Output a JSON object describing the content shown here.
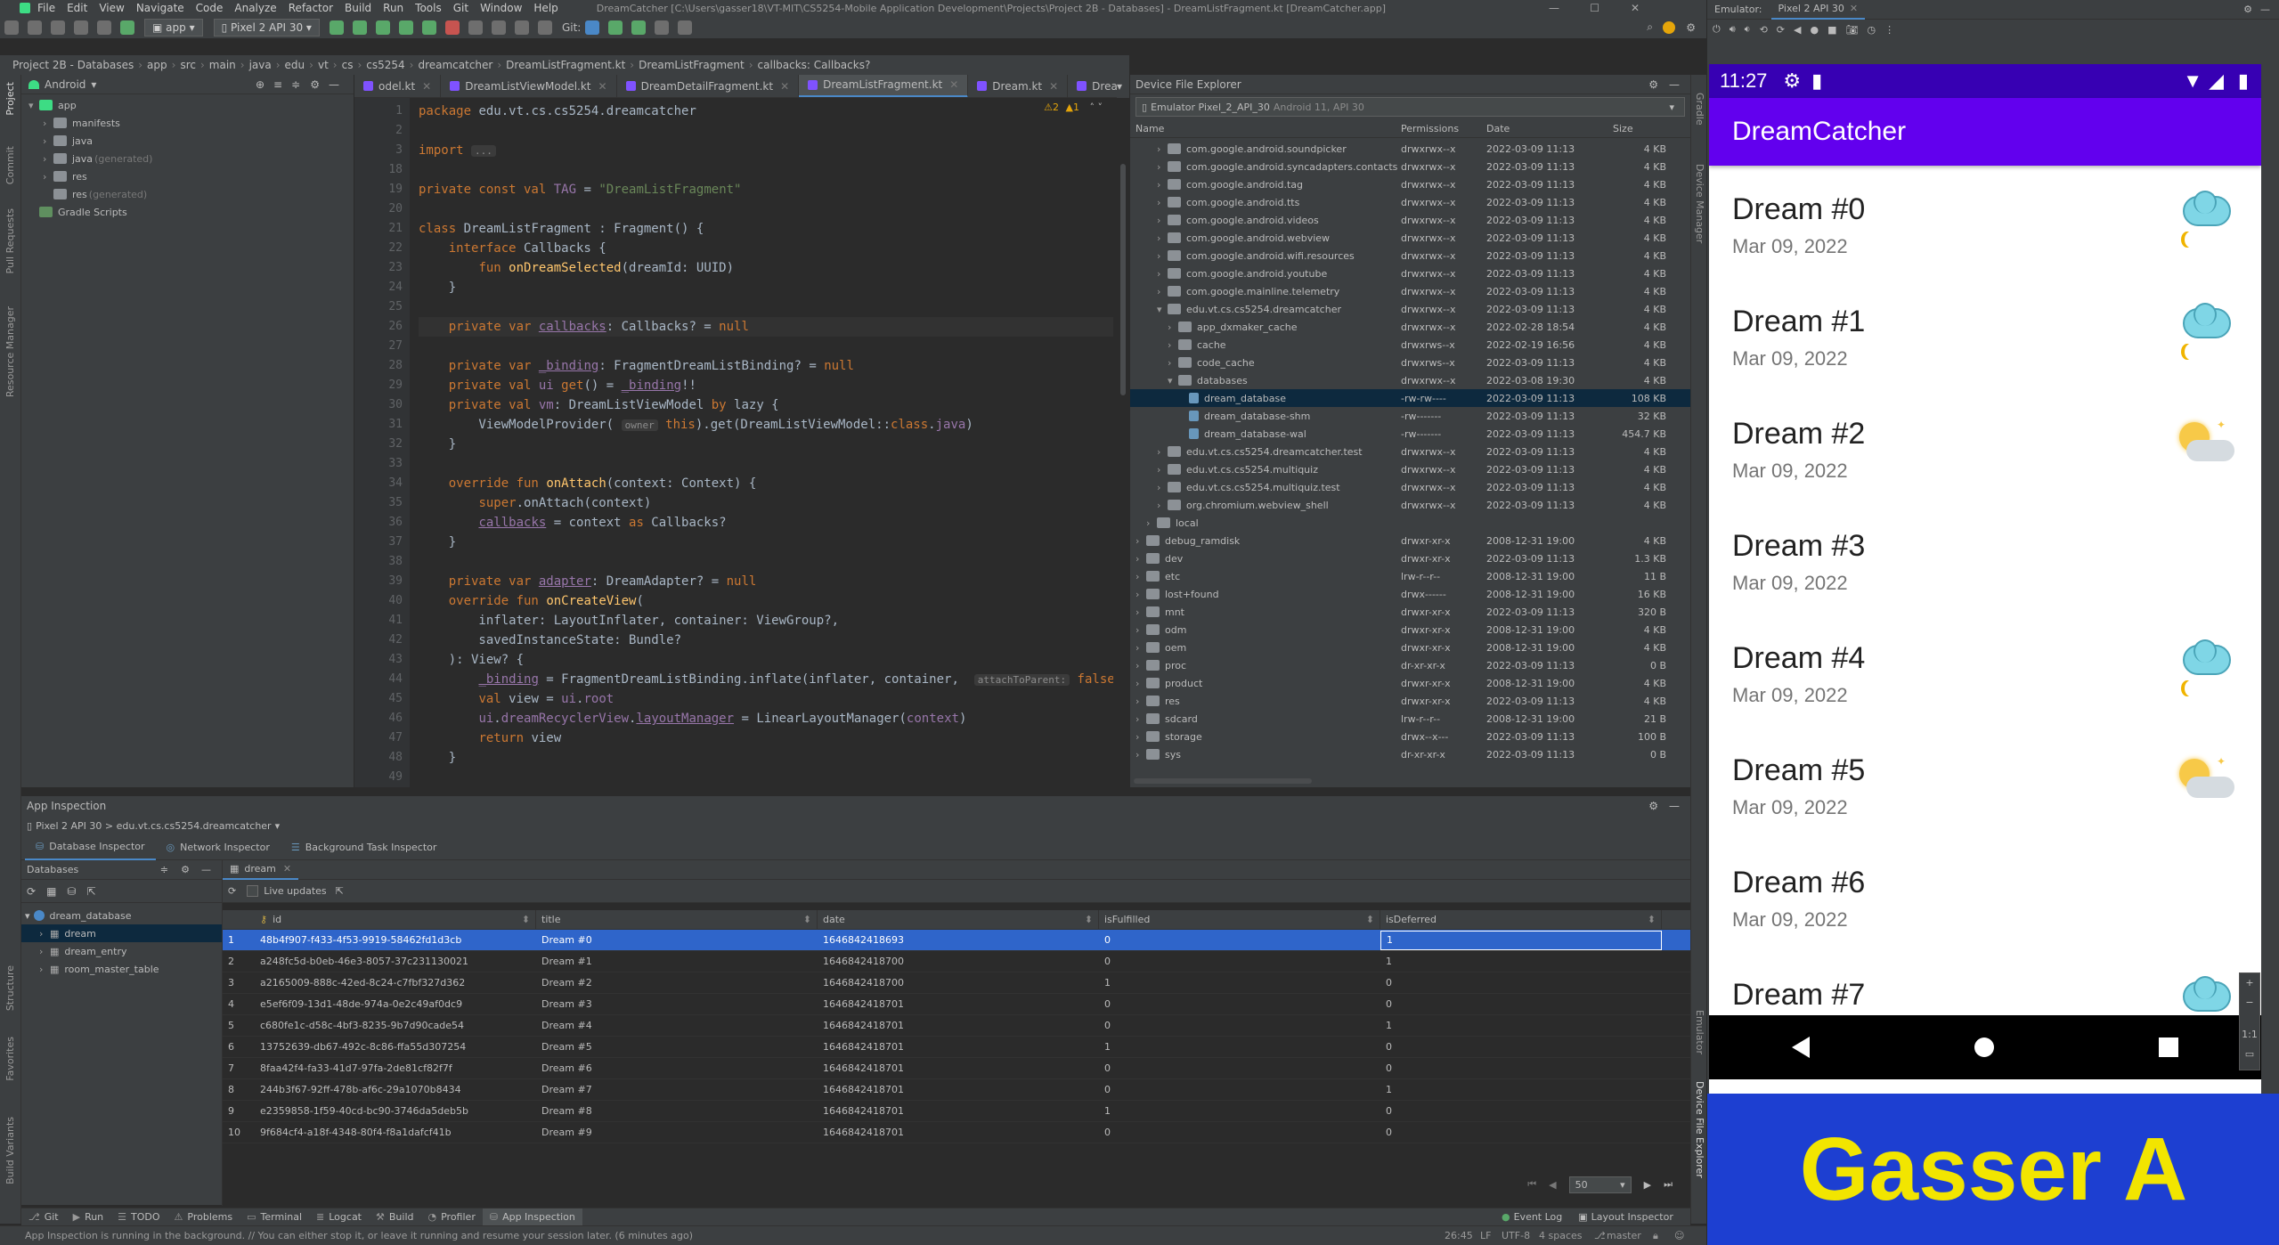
{
  "menu": {
    "items": [
      "File",
      "Edit",
      "View",
      "Navigate",
      "Code",
      "Analyze",
      "Refactor",
      "Build",
      "Run",
      "Tools",
      "Git",
      "Window",
      "Help"
    ],
    "title": "DreamCatcher [C:\\Users\\gasser18\\VT-MIT\\CS5254-Mobile Application Development\\Projects\\Project 2B - Databases] - DreamListFragment.kt [DreamCatcher.app]"
  },
  "toolbar": {
    "config": "app",
    "device": "Pixel 2 API 30",
    "git_label": "Git:"
  },
  "breadcrumb": [
    "Project 2B - Databases",
    "app",
    "src",
    "main",
    "java",
    "edu",
    "vt",
    "cs",
    "cs5254",
    "dreamcatcher",
    "DreamListFragment.kt",
    "DreamListFragment",
    "callbacks: Callbacks?"
  ],
  "project": {
    "view": "Android",
    "tree": [
      {
        "label": "app",
        "suffix": ""
      },
      {
        "label": "manifests",
        "suffix": ""
      },
      {
        "label": "java",
        "suffix": ""
      },
      {
        "label": "java",
        "suffix": " (generated)"
      },
      {
        "label": "res",
        "suffix": ""
      },
      {
        "label": "res",
        "suffix": " (generated)"
      },
      {
        "label": "Gradle Scripts",
        "suffix": ""
      }
    ]
  },
  "editor": {
    "tabs": [
      "odel.kt",
      "DreamListViewModel.kt",
      "DreamDetailFragment.kt",
      "DreamListFragment.kt",
      "Dream.kt",
      "DreamWithEntries.kt"
    ],
    "active_tab": 3,
    "warnings": "⚠2",
    "weak_warnings": "▲1",
    "line_numbers": [
      "1",
      "2",
      "3",
      "18",
      "19",
      "20",
      "21",
      "22",
      "23",
      "24",
      "25",
      "26",
      "27",
      "28",
      "29",
      "30",
      "31",
      "32",
      "33",
      "34",
      "35",
      "36",
      "37",
      "38",
      "39",
      "40",
      "41",
      "42",
      "43",
      "44",
      "45",
      "46",
      "47",
      "48",
      "49"
    ]
  },
  "dfe": {
    "title": "Device File Explorer",
    "device": "Emulator Pixel_2_API_30",
    "device_sub": "Android 11, API 30",
    "columns": [
      "Name",
      "Permissions",
      "Date",
      "Size"
    ],
    "rows": [
      {
        "name": "com.google.android.soundpicker",
        "perm": "drwxrwx--x",
        "date": "2022-03-09 11:13",
        "size": "4 KB",
        "indent": 2,
        "type": "folder"
      },
      {
        "name": "com.google.android.syncadapters.contacts",
        "perm": "drwxrwx--x",
        "date": "2022-03-09 11:13",
        "size": "4 KB",
        "indent": 2,
        "type": "folder"
      },
      {
        "name": "com.google.android.tag",
        "perm": "drwxrwx--x",
        "date": "2022-03-09 11:13",
        "size": "4 KB",
        "indent": 2,
        "type": "folder"
      },
      {
        "name": "com.google.android.tts",
        "perm": "drwxrwx--x",
        "date": "2022-03-09 11:13",
        "size": "4 KB",
        "indent": 2,
        "type": "folder"
      },
      {
        "name": "com.google.android.videos",
        "perm": "drwxrwx--x",
        "date": "2022-03-09 11:13",
        "size": "4 KB",
        "indent": 2,
        "type": "folder"
      },
      {
        "name": "com.google.android.webview",
        "perm": "drwxrwx--x",
        "date": "2022-03-09 11:13",
        "size": "4 KB",
        "indent": 2,
        "type": "folder"
      },
      {
        "name": "com.google.android.wifi.resources",
        "perm": "drwxrwx--x",
        "date": "2022-03-09 11:13",
        "size": "4 KB",
        "indent": 2,
        "type": "folder"
      },
      {
        "name": "com.google.android.youtube",
        "perm": "drwxrwx--x",
        "date": "2022-03-09 11:13",
        "size": "4 KB",
        "indent": 2,
        "type": "folder"
      },
      {
        "name": "com.google.mainline.telemetry",
        "perm": "drwxrwx--x",
        "date": "2022-03-09 11:13",
        "size": "4 KB",
        "indent": 2,
        "type": "folder"
      },
      {
        "name": "edu.vt.cs.cs5254.dreamcatcher",
        "perm": "drwxrwx--x",
        "date": "2022-03-09 11:13",
        "size": "4 KB",
        "indent": 2,
        "type": "folder",
        "open": true
      },
      {
        "name": "app_dxmaker_cache",
        "perm": "drwxrwx--x",
        "date": "2022-02-28 18:54",
        "size": "4 KB",
        "indent": 3,
        "type": "folder"
      },
      {
        "name": "cache",
        "perm": "drwxrws--x",
        "date": "2022-02-19 16:56",
        "size": "4 KB",
        "indent": 3,
        "type": "folder"
      },
      {
        "name": "code_cache",
        "perm": "drwxrws--x",
        "date": "2022-03-09 11:13",
        "size": "4 KB",
        "indent": 3,
        "type": "folder"
      },
      {
        "name": "databases",
        "perm": "drwxrwx--x",
        "date": "2022-03-08 19:30",
        "size": "4 KB",
        "indent": 3,
        "type": "folder",
        "open": true
      },
      {
        "name": "dream_database",
        "perm": "-rw-rw----",
        "date": "2022-03-09 11:13",
        "size": "108 KB",
        "indent": 4,
        "type": "file",
        "selected": true
      },
      {
        "name": "dream_database-shm",
        "perm": "-rw-------",
        "date": "2022-03-09 11:13",
        "size": "32 KB",
        "indent": 4,
        "type": "file"
      },
      {
        "name": "dream_database-wal",
        "perm": "-rw-------",
        "date": "2022-03-09 11:13",
        "size": "454.7 KB",
        "indent": 4,
        "type": "file"
      },
      {
        "name": "edu.vt.cs.cs5254.dreamcatcher.test",
        "perm": "drwxrwx--x",
        "date": "2022-03-09 11:13",
        "size": "4 KB",
        "indent": 2,
        "type": "folder"
      },
      {
        "name": "edu.vt.cs.cs5254.multiquiz",
        "perm": "drwxrwx--x",
        "date": "2022-03-09 11:13",
        "size": "4 KB",
        "indent": 2,
        "type": "folder"
      },
      {
        "name": "edu.vt.cs.cs5254.multiquiz.test",
        "perm": "drwxrwx--x",
        "date": "2022-03-09 11:13",
        "size": "4 KB",
        "indent": 2,
        "type": "folder"
      },
      {
        "name": "org.chromium.webview_shell",
        "perm": "drwxrwx--x",
        "date": "2022-03-09 11:13",
        "size": "4 KB",
        "indent": 2,
        "type": "folder"
      },
      {
        "name": "local",
        "perm": "",
        "date": "",
        "size": "",
        "indent": 1,
        "type": "folder"
      },
      {
        "name": "debug_ramdisk",
        "perm": "drwxr-xr-x",
        "date": "2008-12-31 19:00",
        "size": "4 KB",
        "indent": 0,
        "type": "folder"
      },
      {
        "name": "dev",
        "perm": "drwxr-xr-x",
        "date": "2022-03-09 11:13",
        "size": "1.3 KB",
        "indent": 0,
        "type": "folder"
      },
      {
        "name": "etc",
        "perm": "lrw-r--r--",
        "date": "2008-12-31 19:00",
        "size": "11 B",
        "indent": 0,
        "type": "folder"
      },
      {
        "name": "lost+found",
        "perm": "drwx------",
        "date": "2008-12-31 19:00",
        "size": "16 KB",
        "indent": 0,
        "type": "folder"
      },
      {
        "name": "mnt",
        "perm": "drwxr-xr-x",
        "date": "2022-03-09 11:13",
        "size": "320 B",
        "indent": 0,
        "type": "folder"
      },
      {
        "name": "odm",
        "perm": "drwxr-xr-x",
        "date": "2008-12-31 19:00",
        "size": "4 KB",
        "indent": 0,
        "type": "folder"
      },
      {
        "name": "oem",
        "perm": "drwxr-xr-x",
        "date": "2008-12-31 19:00",
        "size": "4 KB",
        "indent": 0,
        "type": "folder"
      },
      {
        "name": "proc",
        "perm": "dr-xr-xr-x",
        "date": "2022-03-09 11:13",
        "size": "0 B",
        "indent": 0,
        "type": "folder"
      },
      {
        "name": "product",
        "perm": "drwxr-xr-x",
        "date": "2008-12-31 19:00",
        "size": "4 KB",
        "indent": 0,
        "type": "folder"
      },
      {
        "name": "res",
        "perm": "drwxr-xr-x",
        "date": "2022-03-09 11:13",
        "size": "4 KB",
        "indent": 0,
        "type": "folder"
      },
      {
        "name": "sdcard",
        "perm": "lrw-r--r--",
        "date": "2008-12-31 19:00",
        "size": "21 B",
        "indent": 0,
        "type": "folder"
      },
      {
        "name": "storage",
        "perm": "drwx--x---",
        "date": "2022-03-09 11:13",
        "size": "100 B",
        "indent": 0,
        "type": "folder"
      },
      {
        "name": "sys",
        "perm": "dr-xr-xr-x",
        "date": "2022-03-09 11:13",
        "size": "0 B",
        "indent": 0,
        "type": "folder"
      }
    ]
  },
  "inspection": {
    "title": "App Inspection",
    "process": "Pixel 2 API 30 > edu.vt.cs.cs5254.dreamcatcher",
    "tabs": [
      "Database Inspector",
      "Network Inspector",
      "Background Task Inspector"
    ],
    "databases_label": "Databases",
    "db_name": "dream_database",
    "tables": [
      "dream",
      "dream_entry",
      "room_master_table"
    ],
    "table_tab": "dream",
    "live_updates": "Live updates",
    "columns": [
      "id",
      "title",
      "date",
      "isFulfilled",
      "isDeferred"
    ],
    "rows": [
      [
        "1",
        "48b4f907-f433-4f53-9919-58462fd1d3cb",
        "Dream #0",
        "1646842418693",
        "0",
        "1"
      ],
      [
        "2",
        "a248fc5d-b0eb-46e3-8057-37c231130021",
        "Dream #1",
        "1646842418700",
        "0",
        "1"
      ],
      [
        "3",
        "a2165009-888c-42ed-8c24-c7fbf327d362",
        "Dream #2",
        "1646842418700",
        "1",
        "0"
      ],
      [
        "4",
        "e5ef6f09-13d1-48de-974a-0e2c49af0dc9",
        "Dream #3",
        "1646842418701",
        "0",
        "0"
      ],
      [
        "5",
        "c680fe1c-d58c-4bf3-8235-9b7d90cade54",
        "Dream #4",
        "1646842418701",
        "0",
        "1"
      ],
      [
        "6",
        "13752639-db67-492c-8c86-ffa55d307254",
        "Dream #5",
        "1646842418701",
        "1",
        "0"
      ],
      [
        "7",
        "8faa42f4-fa33-41d7-97fa-2de81cf82f7f",
        "Dream #6",
        "1646842418701",
        "0",
        "0"
      ],
      [
        "8",
        "244b3f67-92ff-478b-af6c-29a1070b8434",
        "Dream #7",
        "1646842418701",
        "0",
        "1"
      ],
      [
        "9",
        "e2359858-1f59-40cd-bc90-3746da5deb5b",
        "Dream #8",
        "1646842418701",
        "1",
        "0"
      ],
      [
        "10",
        "9f684cf4-a18f-4348-80f4-f8a1dafcf41b",
        "Dream #9",
        "1646842418701",
        "0",
        "0"
      ]
    ],
    "page_size": "50"
  },
  "bottom_tabs": [
    "Git",
    "Run",
    "TODO",
    "Problems",
    "Terminal",
    "Logcat",
    "Build",
    "Profiler",
    "App Inspection"
  ],
  "bottom_right_tabs": [
    "Event Log",
    "Layout Inspector"
  ],
  "status": {
    "message": "App Inspection is running in the background. // You can either stop it, or leave it running and resume your session later. (6 minutes ago)",
    "position": "26:45",
    "lf": "LF",
    "encoding": "UTF-8",
    "indent": "4 spaces",
    "branch": "master"
  },
  "emulator": {
    "label": "Emulator:",
    "tab": "Pixel 2 API 30",
    "time": "11:27",
    "app_title": "DreamCatcher",
    "app_bar_color": "#6200ee",
    "dreams": [
      {
        "title": "Dream #0",
        "date": "Mar 09, 2022",
        "icon": "cloud-moon"
      },
      {
        "title": "Dream #1",
        "date": "Mar 09, 2022",
        "icon": "cloud-moon"
      },
      {
        "title": "Dream #2",
        "date": "Mar 09, 2022",
        "icon": "sun-cloud"
      },
      {
        "title": "Dream #3",
        "date": "Mar 09, 2022",
        "icon": ""
      },
      {
        "title": "Dream #4",
        "date": "Mar 09, 2022",
        "icon": "cloud-moon"
      },
      {
        "title": "Dream #5",
        "date": "Mar 09, 2022",
        "icon": "sun-cloud"
      },
      {
        "title": "Dream #6",
        "date": "Mar 09, 2022",
        "icon": ""
      },
      {
        "title": "Dream #7",
        "date": "",
        "icon": "cloud-moon"
      }
    ],
    "zoom_label": "1:1"
  },
  "banner": {
    "text": "Gasser A",
    "bg": "#1d3fd1",
    "fg": "#f2e500"
  },
  "side_left": [
    "Project",
    "Commit",
    "Pull Requests",
    "Resource Manager",
    "Structure",
    "Favorites",
    "Build Variants"
  ],
  "side_right": [
    "Gradle",
    "Device Manager",
    "Emulator",
    "Device File Explorer"
  ]
}
